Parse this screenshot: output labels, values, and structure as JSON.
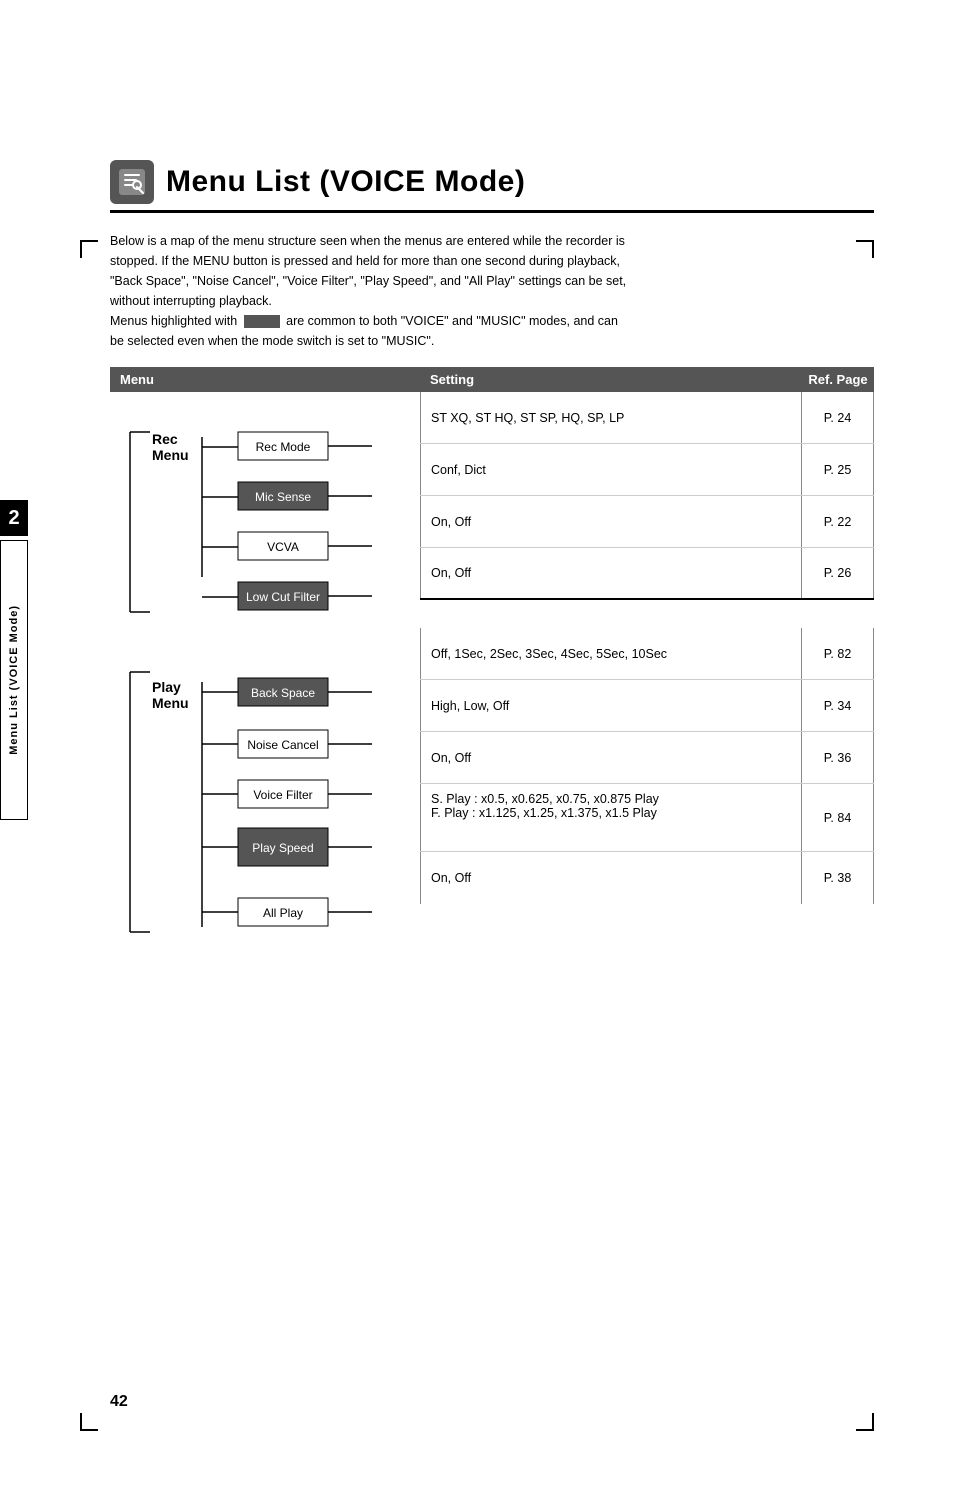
{
  "page": {
    "number": "42",
    "chapter": "2"
  },
  "side_tab": {
    "label": "Menu List (VOICE Mode)"
  },
  "title": "Menu List (VOICE Mode)",
  "description": {
    "line1": "Below is a map of the menu structure seen when the menus are entered while the recorder is",
    "line2": "stopped.  If the MENU button is pressed and held for more than one second during playback,",
    "line3": "\"Back Space\", \"Noise Cancel\", \"Voice Filter\", \"Play Speed\", and \"All Play\" settings can be set,",
    "line4": "without interrupting playback.",
    "line5": "Menus highlighted with",
    "line6": "are common to both \"VOICE\" and \"MUSIC\" modes, and can",
    "line7": "be selected even when the mode switch is set to \"MUSIC\"."
  },
  "table": {
    "col_menu": "Menu",
    "col_setting": "Setting",
    "col_ref": "Ref. Page"
  },
  "rec_menu": {
    "label": "Rec\nMenu",
    "items": [
      {
        "name": "Rec Mode",
        "setting": "ST XQ, ST HQ, ST SP, HQ, SP, LP",
        "ref": "P. 24",
        "highlight": false
      },
      {
        "name": "Mic Sense",
        "setting": "Conf, Dict",
        "ref": "P. 25",
        "highlight": true
      },
      {
        "name": "VCVA",
        "setting": "On, Off",
        "ref": "P. 22",
        "highlight": false
      },
      {
        "name": "Low Cut Filter",
        "setting": "On, Off",
        "ref": "P. 26",
        "highlight": true
      }
    ]
  },
  "play_menu": {
    "label": "Play\nMenu",
    "items": [
      {
        "name": "Back Space",
        "setting": "Off, 1Sec, 2Sec, 3Sec, 4Sec, 5Sec, 10Sec",
        "ref": "P. 82",
        "highlight": true
      },
      {
        "name": "Noise Cancel",
        "setting": "High, Low, Off",
        "ref": "P. 34",
        "highlight": false
      },
      {
        "name": "Voice Filter",
        "setting": "On, Off",
        "ref": "P. 36",
        "highlight": false
      },
      {
        "name": "Play Speed",
        "setting": "S. Play : x0.5, x0.625, x0.75, x0.875 Play\nF. Play : x1.125, x1.25, x1.375, x1.5 Play",
        "ref": "P. 84",
        "highlight": true
      },
      {
        "name": "All Play",
        "setting": "On, Off",
        "ref": "P. 38",
        "highlight": false
      }
    ]
  }
}
